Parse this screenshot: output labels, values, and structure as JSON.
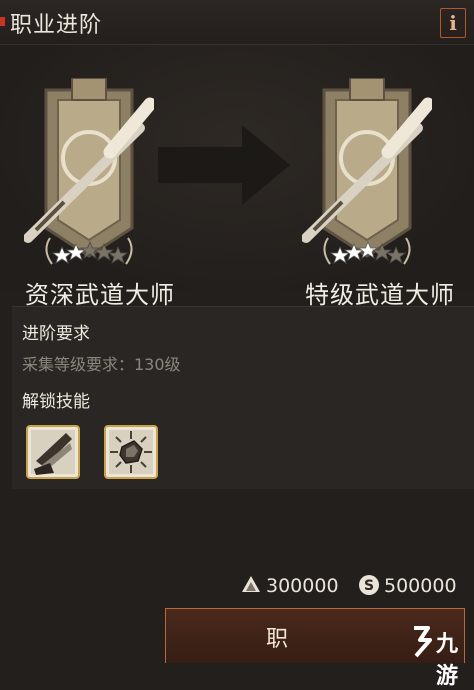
{
  "header": {
    "title": "职业进阶",
    "info_label": "i"
  },
  "current_class": {
    "name": "资深武道大师",
    "stars_filled": 2,
    "stars_total": 5
  },
  "next_class": {
    "name": "特级武道大师",
    "stars_filled": 3,
    "stars_total": 5
  },
  "requirements": {
    "title": "进阶要求",
    "line": "采集等级要求：130级"
  },
  "skills": {
    "title": "解锁技能",
    "items": [
      {
        "icon": "blade-strike-skill-icon"
      },
      {
        "icon": "stone-burst-skill-icon"
      }
    ]
  },
  "costs": [
    {
      "icon": "gold-ore-icon",
      "value": "300000"
    },
    {
      "icon": "silver-coin-icon",
      "value": "500000"
    }
  ],
  "confirm_button": {
    "label": "职"
  },
  "watermark": {
    "text": "九游"
  },
  "colors": {
    "accent": "#b8683a",
    "background": "#231f1c",
    "panel": "#2a2623"
  }
}
